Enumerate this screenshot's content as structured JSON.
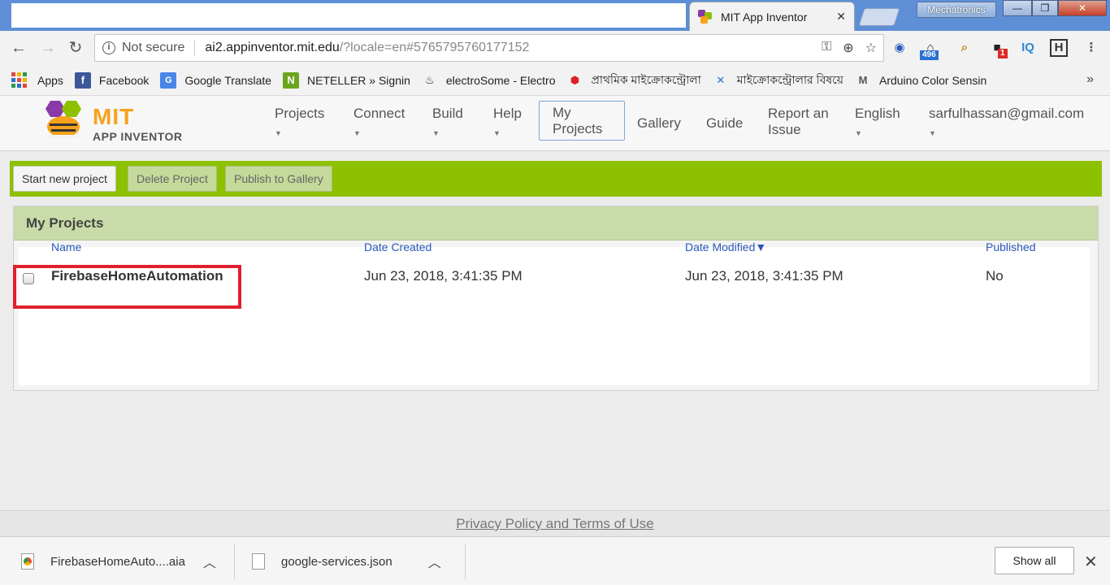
{
  "window": {
    "tab_title": "MIT App Inventor",
    "tab_close": "✕",
    "profile_name": "Mechatronics",
    "minimize": "—",
    "maximize": "❐",
    "close": "✕"
  },
  "address_bar": {
    "security_label": "Not secure",
    "url_host": "ai2.appinventor.mit.edu",
    "url_rest": "/?locale=en#5765795760177152"
  },
  "extensions": {
    "badge_count": "496",
    "notification_count": "1",
    "iq_label": "IQ",
    "h_label": "H"
  },
  "bookmarks": [
    {
      "label": "Apps"
    },
    {
      "label": "Facebook"
    },
    {
      "label": "Google Translate"
    },
    {
      "label": "NETELLER » Signin"
    },
    {
      "label": "electroSome - Electro"
    },
    {
      "label": "প্রাথমিক মাইক্রোকন্ট্রোলা"
    },
    {
      "label": "মাইক্রোকন্ট্রোলার বিষয়ে"
    },
    {
      "label": "Arduino Color Sensin"
    }
  ],
  "bookmarks_more": "»",
  "app": {
    "logo_title": "MIT",
    "logo_subtitle": "APP INVENTOR",
    "menu": {
      "projects": "Projects",
      "connect": "Connect",
      "build": "Build",
      "help": "Help",
      "my_projects_line1": "My",
      "my_projects_line2": "Projects",
      "gallery": "Gallery",
      "guide": "Guide",
      "report_line1": "Report an",
      "report_line2": "Issue",
      "language": "English",
      "account": "sarfulhassan@gmail.com"
    },
    "toolbar": {
      "start_new": "Start new project",
      "delete": "Delete Project",
      "publish": "Publish to Gallery"
    },
    "projects_panel": {
      "title": "My Projects",
      "columns": {
        "name": "Name",
        "date_created": "Date Created",
        "date_modified": "Date Modified",
        "sort_indicator": "▼",
        "published": "Published"
      },
      "rows": [
        {
          "name": "FirebaseHomeAutomation",
          "date_created": "Jun 23, 2018, 3:41:35 PM",
          "date_modified": "Jun 23, 2018, 3:41:35 PM",
          "published": "No"
        }
      ]
    },
    "footer_link": "Privacy Policy and Terms of Use"
  },
  "downloads": {
    "items": [
      {
        "filename": "FirebaseHomeAuto....aia"
      },
      {
        "filename": "google-services.json"
      }
    ],
    "show_all": "Show all",
    "close": "✕"
  },
  "colors": {
    "accent_green": "#8dc100",
    "panel_header": "#c8dba8",
    "link_blue": "#2a58b8",
    "highlight_red": "#e0202e",
    "logo_orange": "#f7a21b"
  }
}
